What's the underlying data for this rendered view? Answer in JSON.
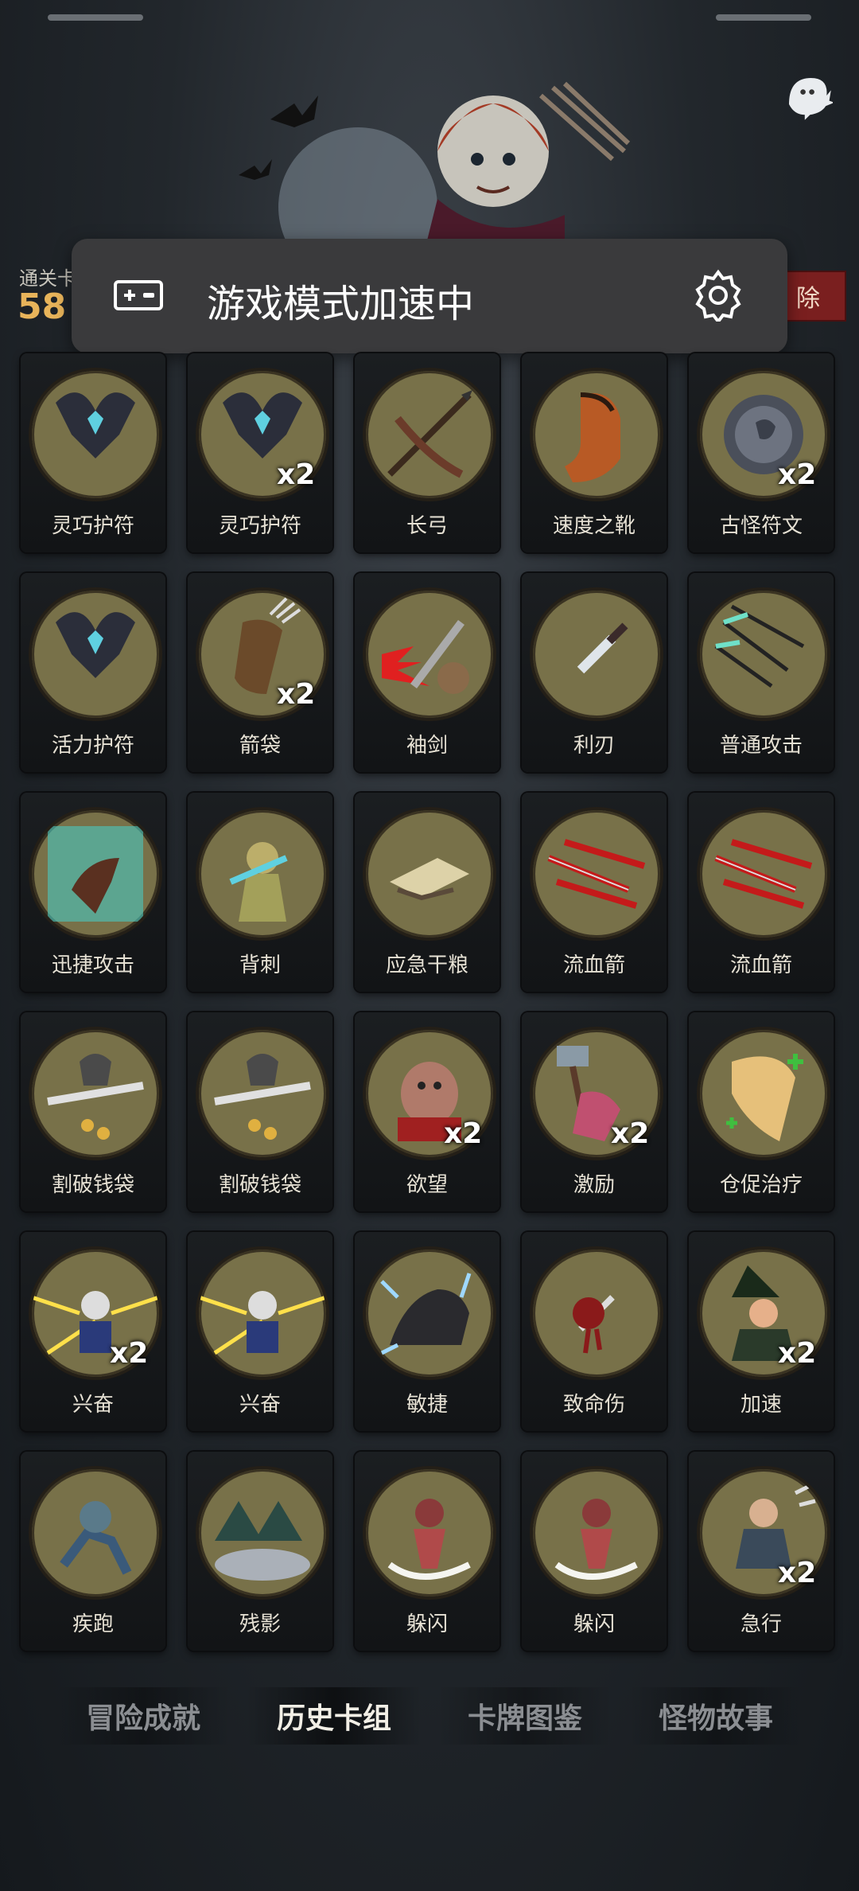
{
  "header": {
    "stage_label": "通关卡",
    "stage_value": "58",
    "red_tag_label": "除"
  },
  "toast": {
    "text": "游戏模式加速中"
  },
  "cards": [
    {
      "name": "灵巧护符",
      "count": "",
      "icon": "amulet-icon"
    },
    {
      "name": "灵巧护符",
      "count": "x2",
      "icon": "amulet-icon"
    },
    {
      "name": "长弓",
      "count": "",
      "icon": "longbow-icon"
    },
    {
      "name": "速度之靴",
      "count": "",
      "icon": "boot-icon"
    },
    {
      "name": "古怪符文",
      "count": "x2",
      "icon": "rune-icon"
    },
    {
      "name": "活力护符",
      "count": "",
      "icon": "amulet-icon"
    },
    {
      "name": "箭袋",
      "count": "x2",
      "icon": "quiver-icon"
    },
    {
      "name": "袖剑",
      "count": "",
      "icon": "blade-icon"
    },
    {
      "name": "利刃",
      "count": "",
      "icon": "dagger-icon"
    },
    {
      "name": "普通攻击",
      "count": "",
      "icon": "arrows-icon"
    },
    {
      "name": "迅捷攻击",
      "count": "",
      "icon": "slash-icon"
    },
    {
      "name": "背刺",
      "count": "",
      "icon": "backstab-icon"
    },
    {
      "name": "应急干粮",
      "count": "",
      "icon": "ration-icon"
    },
    {
      "name": "流血箭",
      "count": "",
      "icon": "bleed-arrow-icon"
    },
    {
      "name": "流血箭",
      "count": "",
      "icon": "bleed-arrow-icon"
    },
    {
      "name": "割破钱袋",
      "count": "",
      "icon": "purse-icon"
    },
    {
      "name": "割破钱袋",
      "count": "",
      "icon": "purse-icon"
    },
    {
      "name": "欲望",
      "count": "x2",
      "icon": "greed-icon"
    },
    {
      "name": "激励",
      "count": "x2",
      "icon": "hammer-icon"
    },
    {
      "name": "仓促治疗",
      "count": "",
      "icon": "scroll-icon"
    },
    {
      "name": "兴奋",
      "count": "x2",
      "icon": "excite-icon"
    },
    {
      "name": "兴奋",
      "count": "",
      "icon": "excite-icon"
    },
    {
      "name": "敏捷",
      "count": "",
      "icon": "panther-icon"
    },
    {
      "name": "致命伤",
      "count": "",
      "icon": "wound-icon"
    },
    {
      "name": "加速",
      "count": "x2",
      "icon": "witch-icon"
    },
    {
      "name": "疾跑",
      "count": "",
      "icon": "run-icon"
    },
    {
      "name": "残影",
      "count": "",
      "icon": "shadow-icon"
    },
    {
      "name": "躲闪",
      "count": "",
      "icon": "dodge-icon"
    },
    {
      "name": "躲闪",
      "count": "",
      "icon": "dodge-icon"
    },
    {
      "name": "急行",
      "count": "x2",
      "icon": "hurry-icon"
    }
  ],
  "tabs": [
    {
      "label": "冒险成就",
      "active": false
    },
    {
      "label": "历史卡组",
      "active": true
    },
    {
      "label": "卡牌图鉴",
      "active": false
    },
    {
      "label": "怪物故事",
      "active": false
    }
  ],
  "colors": {
    "card_art_bg": "#787149",
    "count_badge": "#ffffff",
    "stage_value": "#e8b45a",
    "active_tab": "#f2efe6",
    "inactive_tab": "#8b8e92"
  }
}
